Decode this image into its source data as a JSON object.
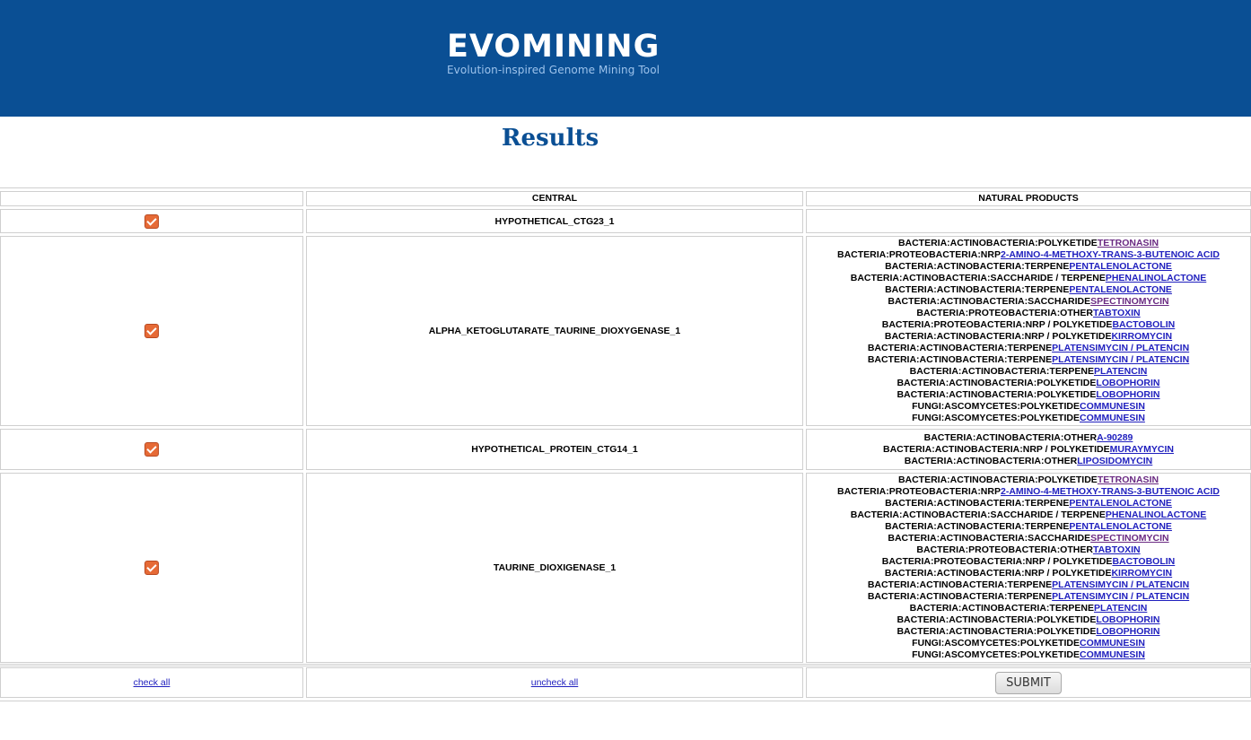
{
  "header": {
    "logo_text": "EVOMINING",
    "logo_tagline": "Evolution-inspired Genome Mining Tool"
  },
  "page_title": "Results",
  "table": {
    "columns": [
      "",
      "CENTRAL",
      "NATURAL PRODUCTS"
    ],
    "rows": [
      {
        "checked": true,
        "central": "HYPOTHETICAL_CTG23_1",
        "products": []
      },
      {
        "checked": true,
        "central": "ALPHA_KETOGLUTARATE_TAURINE_DIOXYGENASE_1",
        "products": [
          {
            "class": "BACTERIA:ACTINOBACTERIA:POLYKETIDE",
            "name": "TETRONASIN",
            "visited": true
          },
          {
            "class": "BACTERIA:PROTEOBACTERIA:NRP",
            "name": "2-AMINO-4-METHOXY-TRANS-3-BUTENOIC ACID",
            "visited": false
          },
          {
            "class": "BACTERIA:ACTINOBACTERIA:TERPENE",
            "name": "PENTALENOLACTONE",
            "visited": false
          },
          {
            "class": "BACTERIA:ACTINOBACTERIA:SACCHARIDE / TERPENE",
            "name": "PHENALINOLACTONE",
            "visited": false
          },
          {
            "class": "BACTERIA:ACTINOBACTERIA:TERPENE",
            "name": "PENTALENOLACTONE",
            "visited": false
          },
          {
            "class": "BACTERIA:ACTINOBACTERIA:SACCHARIDE",
            "name": "SPECTINOMYCIN",
            "visited": true
          },
          {
            "class": "BACTERIA:PROTEOBACTERIA:OTHER",
            "name": "TABTOXIN",
            "visited": false
          },
          {
            "class": "BACTERIA:PROTEOBACTERIA:NRP / POLYKETIDE",
            "name": "BACTOBOLIN",
            "visited": false
          },
          {
            "class": "BACTERIA:ACTINOBACTERIA:NRP / POLYKETIDE",
            "name": "KIRROMYCIN",
            "visited": false
          },
          {
            "class": "BACTERIA:ACTINOBACTERIA:TERPENE",
            "name": "PLATENSIMYCIN / PLATENCIN",
            "visited": false
          },
          {
            "class": "BACTERIA:ACTINOBACTERIA:TERPENE",
            "name": "PLATENSIMYCIN / PLATENCIN",
            "visited": false
          },
          {
            "class": "BACTERIA:ACTINOBACTERIA:TERPENE",
            "name": "PLATENCIN",
            "visited": false
          },
          {
            "class": "BACTERIA:ACTINOBACTERIA:POLYKETIDE",
            "name": "LOBOPHORIN",
            "visited": false
          },
          {
            "class": "BACTERIA:ACTINOBACTERIA:POLYKETIDE",
            "name": "LOBOPHORIN",
            "visited": false
          },
          {
            "class": "FUNGI:ASCOMYCETES:POLYKETIDE",
            "name": "COMMUNESIN",
            "visited": false
          },
          {
            "class": "FUNGI:ASCOMYCETES:POLYKETIDE",
            "name": "COMMUNESIN",
            "visited": false
          }
        ]
      },
      {
        "checked": true,
        "central": "HYPOTHETICAL_PROTEIN_CTG14_1",
        "products": [
          {
            "class": "BACTERIA:ACTINOBACTERIA:OTHER",
            "name": "A-90289",
            "visited": false
          },
          {
            "class": "BACTERIA:ACTINOBACTERIA:NRP / POLYKETIDE",
            "name": "MURAYMYCIN",
            "visited": false
          },
          {
            "class": "BACTERIA:ACTINOBACTERIA:OTHER",
            "name": "LIPOSIDOMYCIN",
            "visited": false
          }
        ]
      },
      {
        "checked": true,
        "central": "TAURINE_DIOXIGENASE_1",
        "products": [
          {
            "class": "BACTERIA:ACTINOBACTERIA:POLYKETIDE",
            "name": "TETRONASIN",
            "visited": true
          },
          {
            "class": "BACTERIA:PROTEOBACTERIA:NRP",
            "name": "2-AMINO-4-METHOXY-TRANS-3-BUTENOIC ACID",
            "visited": false
          },
          {
            "class": "BACTERIA:ACTINOBACTERIA:TERPENE",
            "name": "PENTALENOLACTONE",
            "visited": false
          },
          {
            "class": "BACTERIA:ACTINOBACTERIA:SACCHARIDE / TERPENE",
            "name": "PHENALINOLACTONE",
            "visited": false
          },
          {
            "class": "BACTERIA:ACTINOBACTERIA:TERPENE",
            "name": "PENTALENOLACTONE",
            "visited": false
          },
          {
            "class": "BACTERIA:ACTINOBACTERIA:SACCHARIDE",
            "name": "SPECTINOMYCIN",
            "visited": true
          },
          {
            "class": "BACTERIA:PROTEOBACTERIA:OTHER",
            "name": "TABTOXIN",
            "visited": false
          },
          {
            "class": "BACTERIA:PROTEOBACTERIA:NRP / POLYKETIDE",
            "name": "BACTOBOLIN",
            "visited": false
          },
          {
            "class": "BACTERIA:ACTINOBACTERIA:NRP / POLYKETIDE",
            "name": "KIRROMYCIN",
            "visited": false
          },
          {
            "class": "BACTERIA:ACTINOBACTERIA:TERPENE",
            "name": "PLATENSIMYCIN / PLATENCIN",
            "visited": false
          },
          {
            "class": "BACTERIA:ACTINOBACTERIA:TERPENE",
            "name": "PLATENSIMYCIN / PLATENCIN",
            "visited": false
          },
          {
            "class": "BACTERIA:ACTINOBACTERIA:TERPENE",
            "name": "PLATENCIN",
            "visited": false
          },
          {
            "class": "BACTERIA:ACTINOBACTERIA:POLYKETIDE",
            "name": "LOBOPHORIN",
            "visited": false
          },
          {
            "class": "BACTERIA:ACTINOBACTERIA:POLYKETIDE",
            "name": "LOBOPHORIN",
            "visited": false
          },
          {
            "class": "FUNGI:ASCOMYCETES:POLYKETIDE",
            "name": "COMMUNESIN",
            "visited": false
          },
          {
            "class": "FUNGI:ASCOMYCETES:POLYKETIDE",
            "name": "COMMUNESIN",
            "visited": false
          }
        ]
      }
    ]
  },
  "footer": {
    "check_all": "check all",
    "uncheck_all": "uncheck all",
    "submit": "SUBMIT"
  },
  "colors": {
    "banner": "#0a4f94",
    "checkbox": "#e66a36",
    "link": "#1f1fbe",
    "link_visited": "#6a2a82"
  }
}
